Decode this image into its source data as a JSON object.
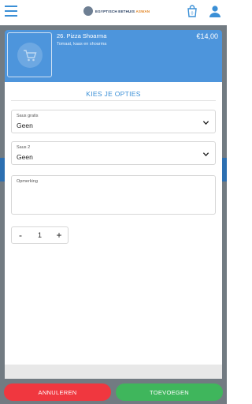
{
  "header": {
    "logo_text_main": "EGYPTISCH EETHUIS",
    "logo_text_accent": "ASWAN",
    "cart_count": "0"
  },
  "product": {
    "name": "26. Pizza Shoarma",
    "description": "Tomaat, kaas en shoarma",
    "price": "€14,00"
  },
  "options": {
    "title": "KIES JE OPTIES",
    "fields": [
      {
        "label": "Saus gratis",
        "value": "Geen"
      },
      {
        "label": "Saus 2",
        "value": "Geen"
      }
    ],
    "remark_label": "Opmerking",
    "quantity": {
      "minus": "-",
      "value": "1",
      "plus": "+"
    }
  },
  "actions": {
    "cancel_label": "ANNULEREN",
    "add_label": "TOEVOEGEN"
  },
  "colors": {
    "accent_blue": "#3a8fd6",
    "card_blue": "#4d95dc",
    "cancel_red": "#f0373f",
    "add_green": "#3fb65c",
    "overlay_gray": "#727b82"
  },
  "icons": {
    "menu": "hamburger-menu-icon",
    "cart": "shopping-bag-icon",
    "user": "user-icon",
    "product_placeholder": "shopping-cart-icon",
    "select_arrow": "chevron-down-icon"
  }
}
